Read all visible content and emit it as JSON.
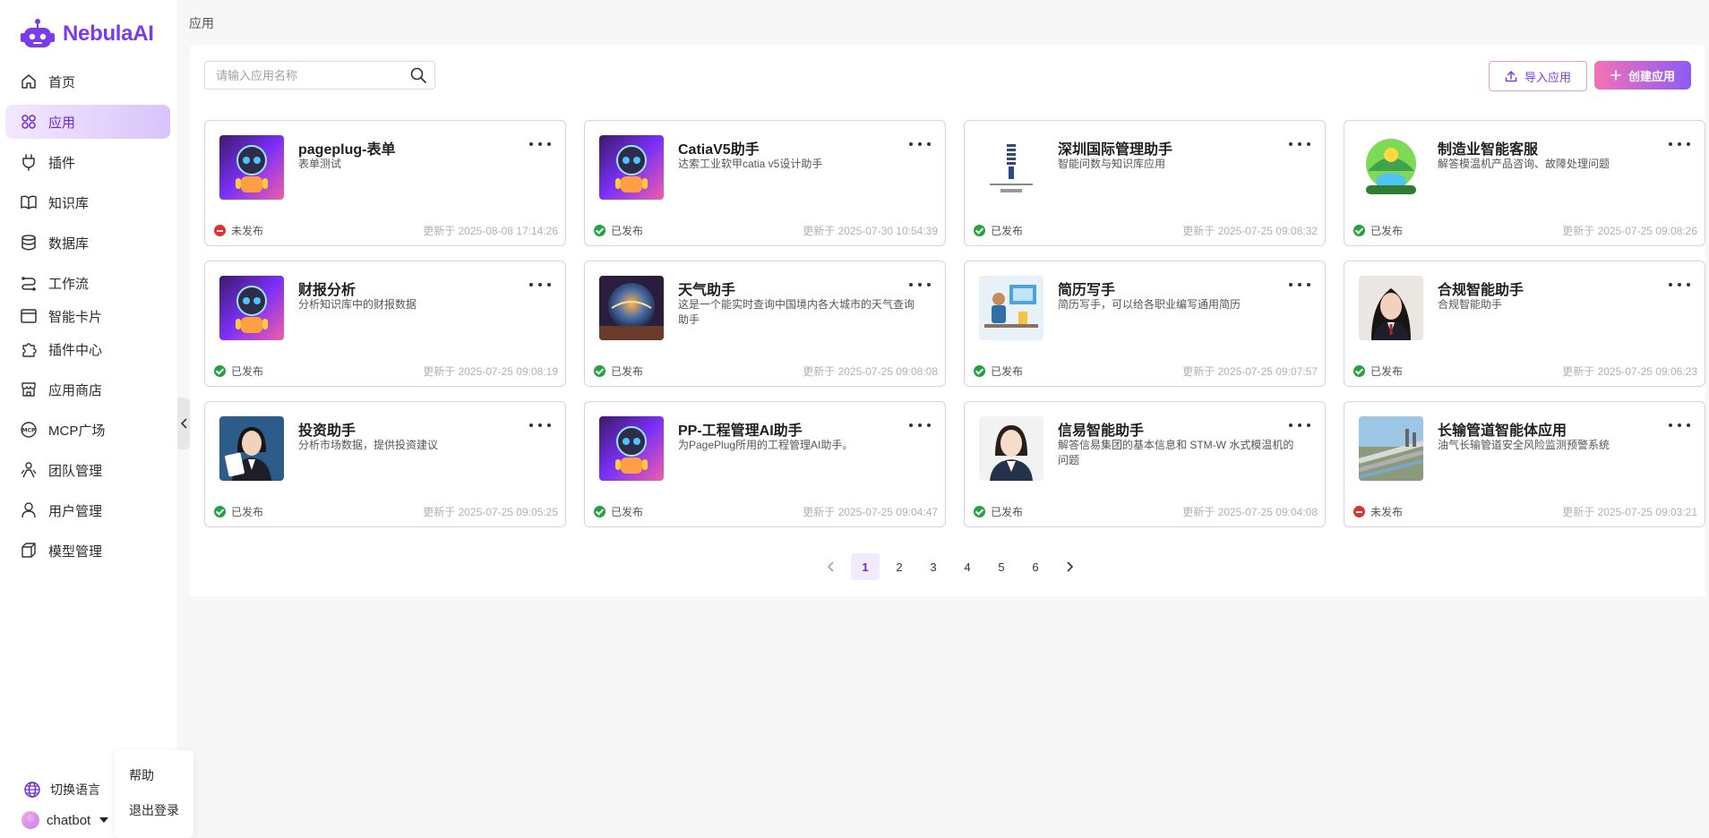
{
  "brand": {
    "name": "NebulaAI",
    "color": "#7c3aed"
  },
  "sidebar": {
    "items": [
      {
        "label": "首页",
        "icon": "home-icon",
        "active": false
      },
      {
        "label": "应用",
        "icon": "apps-icon",
        "active": true
      },
      {
        "label": "插件",
        "icon": "plug-icon",
        "active": false
      },
      {
        "label": "知识库",
        "icon": "book-icon",
        "active": false
      },
      {
        "label": "数据库",
        "icon": "database-icon",
        "active": false
      },
      {
        "label": "工作流",
        "icon": "workflow-icon",
        "active": false
      },
      {
        "label": "智能卡片",
        "icon": "card-icon",
        "active": false
      },
      {
        "label": "插件中心",
        "icon": "puzzle-icon",
        "active": false
      },
      {
        "label": "应用商店",
        "icon": "store-icon",
        "active": false
      },
      {
        "label": "MCP广场",
        "icon": "mcp-icon",
        "active": false
      },
      {
        "label": "团队管理",
        "icon": "team-icon",
        "active": false
      },
      {
        "label": "用户管理",
        "icon": "user-icon",
        "active": false
      },
      {
        "label": "模型管理",
        "icon": "cube-icon",
        "active": false
      }
    ],
    "language_label": "切换语言",
    "username": "chatbot"
  },
  "user_menu": {
    "help": "帮助",
    "logout": "退出登录"
  },
  "breadcrumb": "应用",
  "search": {
    "placeholder": "请输入应用名称",
    "value": ""
  },
  "toolbar": {
    "import_label": "导入应用",
    "create_label": "创建应用"
  },
  "apps": [
    {
      "title": "pageplug-表单",
      "desc": "表单测试",
      "status": "未发布",
      "published": false,
      "updated": "更新于 2025-08-08 17:14:26",
      "thumb": "robot"
    },
    {
      "title": "CatiaV5助手",
      "desc": "达索工业软甲catia v5设计助手",
      "status": "已发布",
      "published": true,
      "updated": "更新于 2025-07-30 10:54:39",
      "thumb": "robot"
    },
    {
      "title": "深圳国际管理助手",
      "desc": "智能问数与知识库应用",
      "status": "已发布",
      "published": true,
      "updated": "更新于 2025-07-25 09:08:32",
      "thumb": "logo-shenzhen"
    },
    {
      "title": "制造业智能客服",
      "desc": "解答模温机产品咨询、故障处理问题",
      "status": "已发布",
      "published": true,
      "updated": "更新于 2025-07-25 09:08:26",
      "thumb": "landscape"
    },
    {
      "title": "财报分析",
      "desc": "分析知识库中的财报数据",
      "status": "已发布",
      "published": true,
      "updated": "更新于 2025-07-25 09:08:19",
      "thumb": "robot"
    },
    {
      "title": "天气助手",
      "desc": "这是一个能实时查询中国境内各大城市的天气查询助手",
      "status": "已发布",
      "published": true,
      "updated": "更新于 2025-07-25 09:08:08",
      "thumb": "globe"
    },
    {
      "title": "简历写手",
      "desc": "简历写手，可以给各职业编写通用简历",
      "status": "已发布",
      "published": true,
      "updated": "更新于 2025-07-25 09:07:57",
      "thumb": "office"
    },
    {
      "title": "合规智能助手",
      "desc": "合规智能助手",
      "status": "已发布",
      "published": true,
      "updated": "更新于 2025-07-25 09:06:23",
      "thumb": "portrait-dark"
    },
    {
      "title": "投资助手",
      "desc": "分析市场数据，提供投资建议",
      "status": "已发布",
      "published": true,
      "updated": "更新于 2025-07-25 09:05:25",
      "thumb": "portrait-blue"
    },
    {
      "title": "PP-工程管理AI助手",
      "desc": "为PagePlug所用的工程管理AI助手。",
      "status": "已发布",
      "published": true,
      "updated": "更新于 2025-07-25 09:04:47",
      "thumb": "robot"
    },
    {
      "title": "信易智能助手",
      "desc": "解答信易集团的基本信息和 STM-W 水式模温机的问题",
      "status": "已发布",
      "published": true,
      "updated": "更新于 2025-07-25 09:04:08",
      "thumb": "portrait-light"
    },
    {
      "title": "长输管道智能体应用",
      "desc": "油气长输管道安全风险监测预警系统",
      "status": "未发布",
      "published": false,
      "updated": "更新于 2025-07-25 09:03:21",
      "thumb": "pipeline"
    }
  ],
  "pagination": {
    "pages": [
      "1",
      "2",
      "3",
      "4",
      "5",
      "6"
    ],
    "current": "1"
  },
  "colors": {
    "accent": "#7c3aed",
    "published": "#22a33f",
    "unpublished": "#e03131",
    "card_border": "#d8cdf4"
  }
}
